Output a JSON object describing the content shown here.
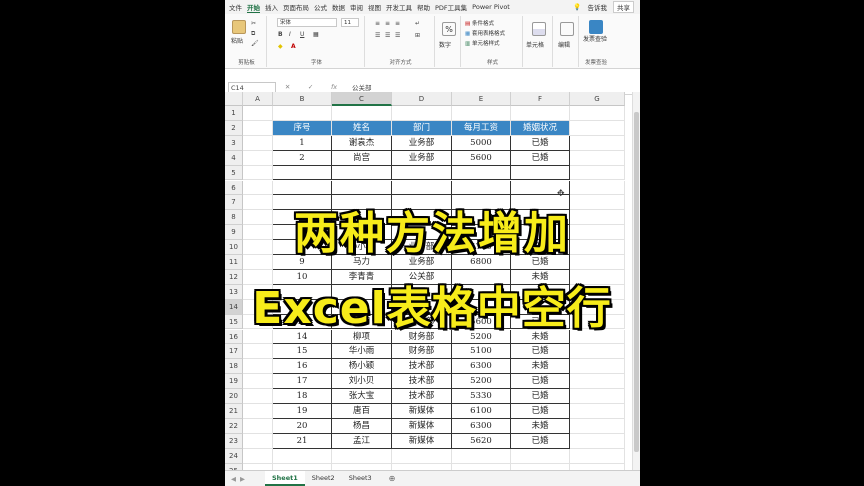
{
  "menu": {
    "tabs": [
      "文件",
      "开始",
      "插入",
      "页面布局",
      "公式",
      "数据",
      "审阅",
      "视图",
      "开发工具",
      "帮助",
      "PDF工具集",
      "Power Pivot"
    ],
    "active": "开始",
    "tell_me": "告诉我",
    "share": "共享"
  },
  "ribbon": {
    "clipboard": {
      "paste": "粘贴",
      "label": "剪贴板"
    },
    "font": {
      "name": "宋体",
      "size": "11",
      "label": "字体",
      "bold": "B",
      "italic": "I",
      "underline": "U",
      "font_color": "A"
    },
    "alignment": {
      "label": "对齐方式"
    },
    "number": {
      "symbol": "%",
      "label": "数字"
    },
    "styles": {
      "conditional": "条件格式",
      "table_format": "套用表格格式",
      "cell_styles": "单元格样式",
      "label": "样式"
    },
    "cells": {
      "label": "单元格"
    },
    "editing": {
      "label": "编辑"
    },
    "invoice": {
      "label": "发票查验",
      "button": "发票查验"
    }
  },
  "formula_bar": {
    "name_box": "C14",
    "cancel": "✕",
    "confirm": "✓",
    "fx": "fx",
    "value": "公关部"
  },
  "columns": [
    "A",
    "B",
    "C",
    "D",
    "E",
    "F",
    "G"
  ],
  "header_row": [
    "序号",
    "姓名",
    "部门",
    "每月工资",
    "婚姻状况"
  ],
  "rows": [
    {
      "n": "1",
      "cells": [
        "",
        "",
        "",
        "",
        ""
      ]
    },
    {
      "n": "2",
      "cells": [
        "序号",
        "姓名",
        "部门",
        "每月工资",
        "婚姻状况"
      ]
    },
    {
      "n": "3",
      "cells": [
        "1",
        "谢袁杰",
        "业务部",
        "5000",
        "已婚"
      ]
    },
    {
      "n": "4",
      "cells": [
        "2",
        "尚宫",
        "业务部",
        "5600",
        "已婚"
      ]
    },
    {
      "n": "5",
      "cells": [
        "",
        "",
        "",
        "",
        ""
      ]
    },
    {
      "n": "6",
      "cells": [
        "",
        "",
        "",
        "",
        ""
      ]
    },
    {
      "n": "7",
      "cells": [
        "",
        "",
        "",
        "",
        ""
      ]
    },
    {
      "n": "8",
      "cells": [
        "",
        "",
        "",
        "",
        ""
      ]
    },
    {
      "n": "9",
      "cells": [
        "7",
        "",
        "",
        "",
        ""
      ]
    },
    {
      "n": "10",
      "cells": [
        "8",
        "孙小杰",
        "业务部",
        "5700",
        "已婚"
      ]
    },
    {
      "n": "11",
      "cells": [
        "9",
        "马力",
        "业务部",
        "6800",
        "已婚"
      ]
    },
    {
      "n": "12",
      "cells": [
        "10",
        "李青青",
        "公关部",
        "",
        "未婚"
      ]
    },
    {
      "n": "13",
      "cells": [
        "",
        "",
        "",
        "",
        ""
      ]
    },
    {
      "n": "14",
      "cells": [
        "",
        "",
        "",
        "",
        ""
      ]
    },
    {
      "n": "15",
      "cells": [
        "13",
        "墨卿",
        "财务部",
        "5600",
        "已婚"
      ]
    },
    {
      "n": "16",
      "cells": [
        "14",
        "柳项",
        "财务部",
        "5200",
        "未婚"
      ]
    },
    {
      "n": "17",
      "cells": [
        "15",
        "华小雨",
        "财务部",
        "5100",
        "已婚"
      ]
    },
    {
      "n": "18",
      "cells": [
        "16",
        "杨小颖",
        "技术部",
        "6300",
        "未婚"
      ]
    },
    {
      "n": "19",
      "cells": [
        "17",
        "刘小贝",
        "技术部",
        "5200",
        "已婚"
      ]
    },
    {
      "n": "20",
      "cells": [
        "18",
        "张大宝",
        "技术部",
        "5330",
        "已婚"
      ]
    },
    {
      "n": "21",
      "cells": [
        "19",
        "唐百",
        "新媒体",
        "6100",
        "已婚"
      ]
    },
    {
      "n": "22",
      "cells": [
        "20",
        "杨昌",
        "新媒体",
        "6300",
        "未婚"
      ]
    },
    {
      "n": "23",
      "cells": [
        "21",
        "孟江",
        "新媒体",
        "5620",
        "已婚"
      ]
    },
    {
      "n": "24",
      "cells": [
        "",
        "",
        "",
        "",
        ""
      ]
    },
    {
      "n": "25",
      "cells": [
        "",
        "",
        "",
        "",
        ""
      ]
    }
  ],
  "sheets": [
    "Sheet1",
    "Sheet2",
    "Sheet3"
  ],
  "active_sheet": "Sheet1",
  "overlay": {
    "line1": "两种方法增加",
    "line2": "Excel表格中空行"
  },
  "colors": {
    "header_fill": "#3a86c4",
    "overlay_text": "#f7ec1a",
    "excel_green": "#217346"
  }
}
